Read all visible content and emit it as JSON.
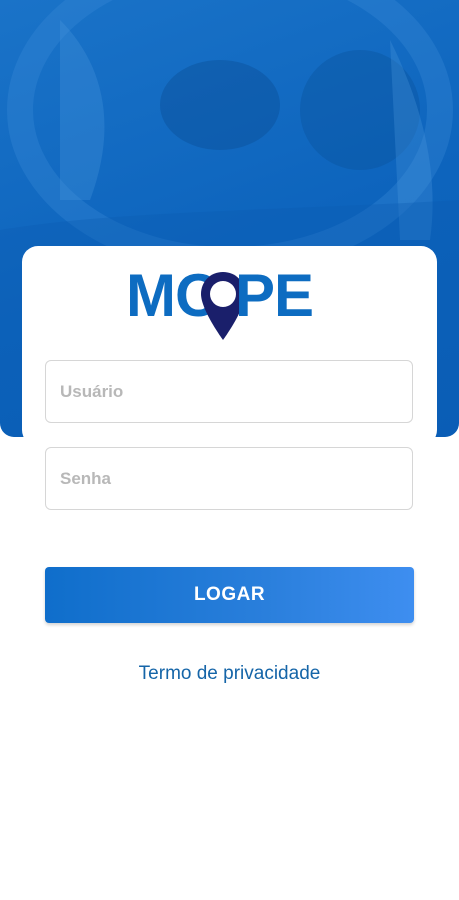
{
  "colors": {
    "hero_blue": "#0d64bd",
    "logo_blue": "#0d6cc1",
    "pin_navy": "#1a1f6b",
    "button_start": "#0f6ecb",
    "button_end": "#3e8ef0",
    "link": "#1565a8"
  },
  "logo": {
    "left_letters": "MO",
    "right_letters": "PE",
    "pin_icon": "map-pin-icon"
  },
  "form": {
    "username_placeholder": "Usuário",
    "password_placeholder": "Senha",
    "login_label": "LOGAR"
  },
  "links": {
    "privacy": "Termo de privacidade"
  }
}
